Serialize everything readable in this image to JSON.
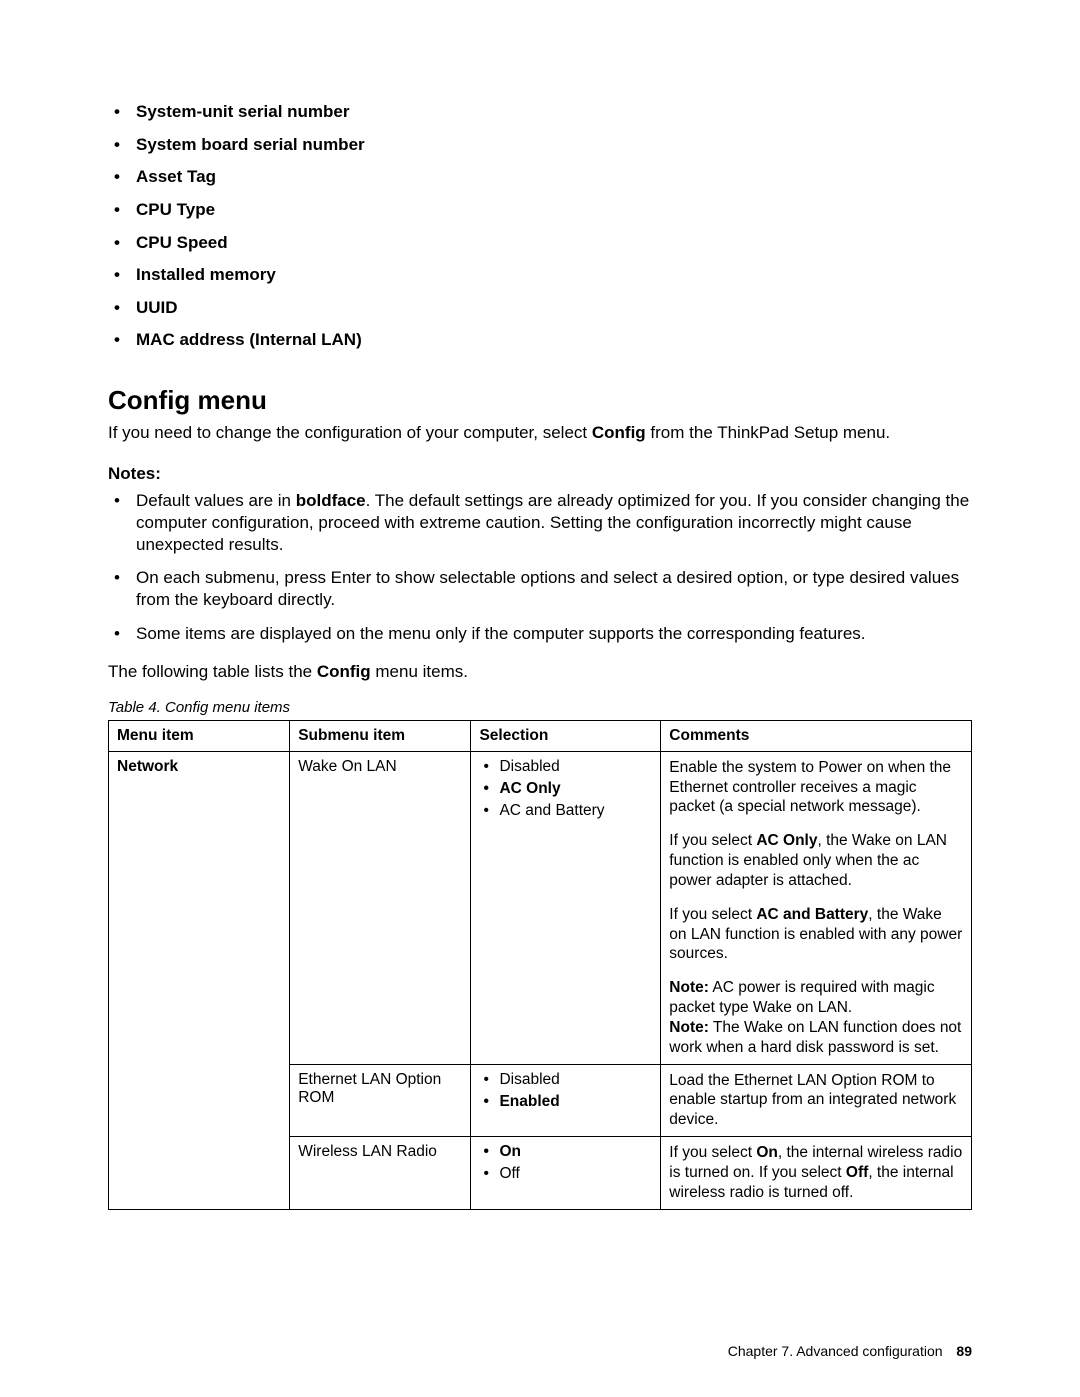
{
  "top_list": [
    "System-unit serial number",
    "System board serial number",
    "Asset Tag",
    "CPU Type",
    "CPU Speed",
    "Installed memory",
    "UUID",
    "MAC address (Internal LAN)"
  ],
  "section_title": "Config menu",
  "intro": {
    "pre": "If you need to change the configuration of your computer, select ",
    "bold": "Config",
    "post": " from the ThinkPad Setup menu."
  },
  "notes_label": "Notes:",
  "notes": {
    "n1": {
      "pre": "Default values are in ",
      "bold": "boldface",
      "post": ". The default settings are already optimized for you. If you consider changing the computer configuration, proceed with extreme caution. Setting the configuration incorrectly might cause unexpected results."
    },
    "n2": "On each submenu, press Enter to show selectable options and select a desired option, or type desired values from the keyboard directly.",
    "n3": "Some items are displayed on the menu only if the computer supports the corresponding features."
  },
  "table_lead": {
    "pre": "The following table lists the ",
    "bold": "Config",
    "post": " menu items."
  },
  "table_caption": "Table 4. Config menu items",
  "headers": {
    "h1": "Menu item",
    "h2": "Submenu item",
    "h3": "Selection",
    "h4": "Comments"
  },
  "rows": {
    "r1": {
      "menu": "Network",
      "sub": "Wake On LAN",
      "sel": {
        "s1": "Disabled",
        "s2": "AC Only",
        "s3": "AC and Battery"
      },
      "c": {
        "p1": "Enable the system to Power on when the Ethernet controller receives a magic packet (a special network message).",
        "p2a": "If you select ",
        "p2b": "AC Only",
        "p2c": ", the Wake on LAN function is enabled only when the ac power adapter is attached.",
        "p3a": "If you select ",
        "p3b": "AC and Battery",
        "p3c": ", the Wake on LAN function is enabled with any power sources.",
        "p4a": "Note:",
        "p4b": " AC power is required with magic packet type Wake on LAN.",
        "p5a": "Note:",
        "p5b": " The Wake on LAN function does not work when a hard disk password is set."
      }
    },
    "r2": {
      "sub": "Ethernet LAN Option ROM",
      "sel": {
        "s1": "Disabled",
        "s2": "Enabled"
      },
      "c": "Load the Ethernet LAN Option ROM to enable startup from an integrated network device."
    },
    "r3": {
      "sub": "Wireless LAN Radio",
      "sel": {
        "s1": "On",
        "s2": "Off"
      },
      "c": {
        "a": "If you select ",
        "b": "On",
        "c": ", the internal wireless radio is turned on. If you select ",
        "d": "Off",
        "e": ", the internal wireless radio is turned off."
      }
    }
  },
  "footer": {
    "chapter": "Chapter 7. Advanced configuration",
    "page": "89"
  }
}
